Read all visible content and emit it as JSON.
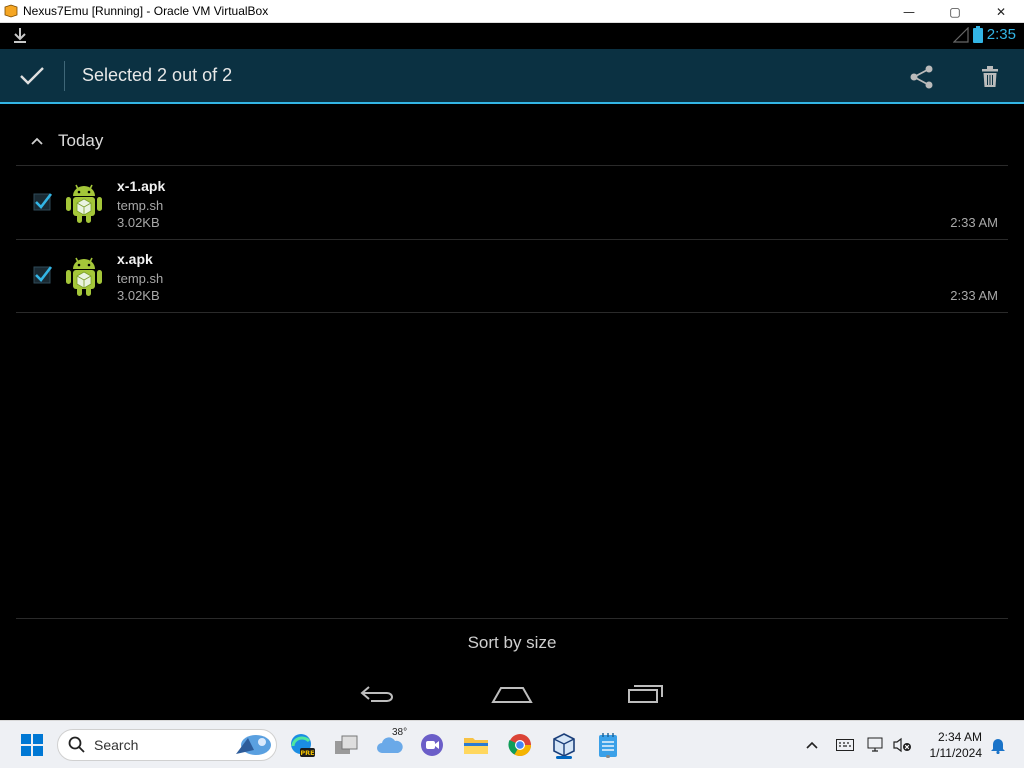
{
  "window": {
    "title": "Nexus7Emu [Running] - Oracle VM VirtualBox",
    "minimize_glyph": "—",
    "maximize_glyph": "▢",
    "close_glyph": "✕"
  },
  "status_bar": {
    "time": "2:35",
    "icons": [
      "download-icon",
      "signal-icon",
      "battery-icon"
    ]
  },
  "action_bar": {
    "title": "Selected 2 out of 2",
    "actions": [
      "share-icon",
      "delete-icon"
    ]
  },
  "section": {
    "title": "Today",
    "expanded": true
  },
  "files": [
    {
      "name": "x-1.apk",
      "source": "temp.sh",
      "size": "3.02KB",
      "time": "2:33 AM",
      "checked": true
    },
    {
      "name": "x.apk",
      "source": "temp.sh",
      "size": "3.02KB",
      "time": "2:33 AM",
      "checked": true
    }
  ],
  "sort": {
    "label": "Sort by size"
  },
  "nav": [
    "back-icon",
    "home-icon",
    "recents-icon"
  ],
  "taskbar": {
    "search_label": "Search",
    "weather_temp": "38°",
    "clock_time": "2:34 AM",
    "clock_date": "1/11/2024",
    "apps": [
      "start-icon",
      "search",
      "edge-pre-icon",
      "task-view-icon",
      "weather-icon",
      "teams-icon",
      "file-explorer-icon",
      "chrome-icon",
      "virtualbox-icon",
      "notepad-icon"
    ]
  },
  "colors": {
    "accent": "#33b5e5",
    "action_bar_bg": "#0b3142",
    "android_green": "#a4c639"
  }
}
